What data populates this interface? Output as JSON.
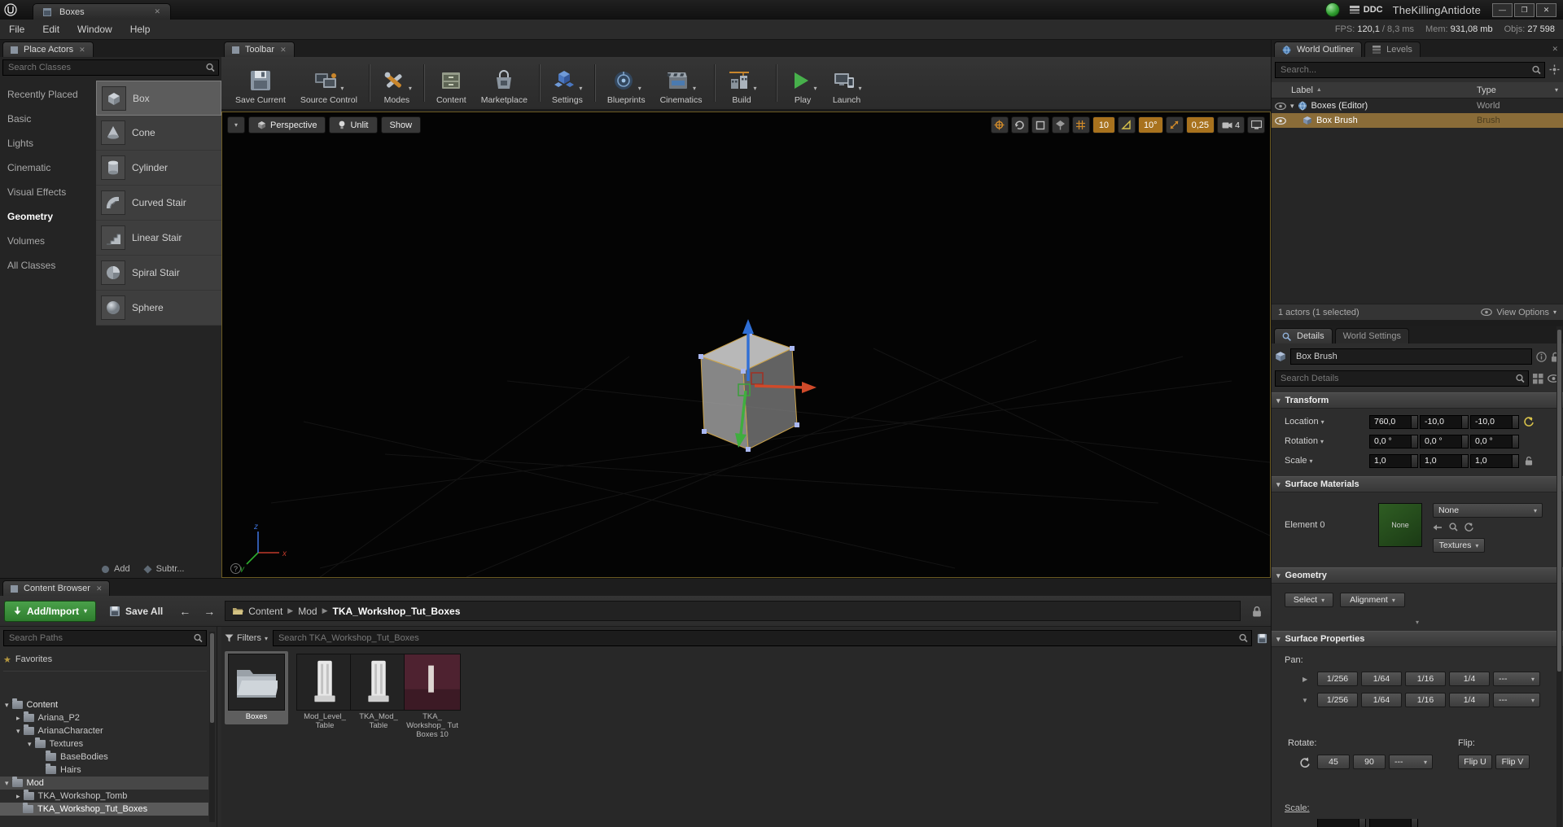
{
  "titlebar": {
    "tab": "Boxes",
    "ddc": "DDC",
    "project": "TheKillingAntidote",
    "window": {
      "min": "—",
      "max": "❐",
      "close": "✕"
    }
  },
  "menubar": {
    "items": [
      {
        "label": "File"
      },
      {
        "label": "Edit"
      },
      {
        "label": "Window"
      },
      {
        "label": "Help"
      }
    ],
    "stats": {
      "fps_label": "FPS:",
      "fps_value": "120,1",
      "ms_value": "/ 8,3 ms",
      "mem_label": "Mem:",
      "mem_value": "931,08 mb",
      "objs_label": "Objs:",
      "objs_value": "27 598"
    }
  },
  "place_actors": {
    "title": "Place Actors",
    "search_placeholder": "Search Classes",
    "categories": [
      {
        "label": "Recently Placed"
      },
      {
        "label": "Basic"
      },
      {
        "label": "Lights"
      },
      {
        "label": "Cinematic"
      },
      {
        "label": "Visual Effects"
      },
      {
        "label": "Geometry"
      },
      {
        "label": "Volumes"
      },
      {
        "label": "All Classes"
      }
    ],
    "items": [
      {
        "label": "Box"
      },
      {
        "label": "Cone"
      },
      {
        "label": "Cylinder"
      },
      {
        "label": "Curved Stair"
      },
      {
        "label": "Linear Stair"
      },
      {
        "label": "Spiral Stair"
      },
      {
        "label": "Sphere"
      }
    ],
    "add_label": "Add",
    "subtract_label": "Subtr..."
  },
  "toolbar": {
    "title": "Toolbar",
    "buttons": [
      {
        "label": "Save Current"
      },
      {
        "label": "Source Control"
      },
      {
        "label": "Modes"
      },
      {
        "label": "Content"
      },
      {
        "label": "Marketplace"
      },
      {
        "label": "Settings"
      },
      {
        "label": "Blueprints"
      },
      {
        "label": "Cinematics"
      },
      {
        "label": "Build"
      },
      {
        "label": "Play"
      },
      {
        "label": "Launch"
      }
    ]
  },
  "viewport": {
    "perspective": "Perspective",
    "unlit": "Unlit",
    "show": "Show",
    "grid_snap": "10",
    "rotation_snap": "10°",
    "scale_snap": "0,25",
    "camera_speed": "4",
    "axis_x": "x",
    "axis_y": "y",
    "axis_z": "z",
    "help": "?"
  },
  "world_outliner": {
    "tab": "World Outliner",
    "levels_tab": "Levels",
    "search_placeholder": "Search...",
    "col_label": "Label",
    "col_type": "Type",
    "rows": [
      {
        "label": "Boxes (Editor)",
        "type": "World"
      },
      {
        "label": "Box Brush",
        "type": "Brush"
      }
    ],
    "footer": "1 actors (1 selected)",
    "view_options": "View Options"
  },
  "details": {
    "tab": "Details",
    "world_settings_tab": "World Settings",
    "name_value": "Box Brush",
    "search_placeholder": "Search Details",
    "transform": {
      "title": "Transform",
      "location_label": "Location",
      "location": [
        "760,0",
        "-10,0",
        "-10,0"
      ],
      "rotation_label": "Rotation",
      "rotation": [
        "0,0 °",
        "0,0 °",
        "0,0 °"
      ],
      "scale_label": "Scale",
      "scale": [
        "1,0",
        "1,0",
        "1,0"
      ]
    },
    "surface_materials": {
      "title": "Surface Materials",
      "element_label": "Element 0",
      "thumb_label": "None",
      "combo_value": "None",
      "textures_button": "Textures"
    },
    "geometry": {
      "title": "Geometry",
      "select_button": "Select",
      "alignment_button": "Alignment"
    },
    "surface_properties": {
      "title": "Surface Properties",
      "pan_label": "Pan:",
      "pan_buttons": [
        "1/256",
        "1/64",
        "1/16",
        "1/4",
        "---"
      ],
      "rotate_label": "Rotate:",
      "rotate_buttons": [
        "45",
        "90",
        "---"
      ],
      "flip_label": "Flip:",
      "flip_u": "Flip U",
      "flip_v": "Flip V",
      "scale_label": "Scale:"
    }
  },
  "content_browser": {
    "tab": "Content Browser",
    "add_import": "Add/Import",
    "save_all": "Save All",
    "breadcrumb": [
      {
        "label": "Content"
      },
      {
        "label": "Mod"
      },
      {
        "label": "TKA_Workshop_Tut_Boxes"
      }
    ],
    "filters": "Filters",
    "search_placeholder": "Search TKA_Workshop_Tut_Boxes",
    "paths_search_placeholder": "Search Paths",
    "favorites": "Favorites",
    "tree": [
      {
        "label": "Content"
      },
      {
        "label": "Ariana_P2"
      },
      {
        "label": "ArianaCharacter"
      },
      {
        "label": "Textures"
      },
      {
        "label": "BaseBodies"
      },
      {
        "label": "Hairs"
      },
      {
        "label": "Mod"
      },
      {
        "label": "TKA_Workshop_Tomb"
      },
      {
        "label": "TKA_Workshop_Tut_Boxes"
      }
    ],
    "assets": [
      {
        "name": "Boxes"
      },
      {
        "name": "Mod_Level_ Table"
      },
      {
        "name": "TKA_Mod_ Table"
      },
      {
        "name": "TKA_ Workshop_ Tut Boxes 10"
      }
    ]
  },
  "colors": {
    "selection_tan": "#8a6c38",
    "accent_green": "#2e7d2e",
    "snap_orange": "#a8721e"
  }
}
